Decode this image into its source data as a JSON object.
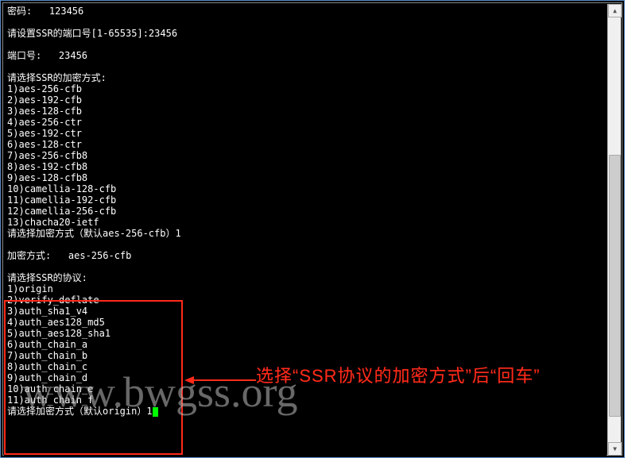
{
  "terminal": {
    "pwd_label": "密码:   123456",
    "port_prompt": "请设置SSR的端口号[1-65535]:23456",
    "port_label": "端口号:   23456",
    "enc_header": "请选择SSR的加密方式:",
    "enc_opts": [
      "1)aes-256-cfb",
      "2)aes-192-cfb",
      "3)aes-128-cfb",
      "4)aes-256-ctr",
      "5)aes-192-ctr",
      "6)aes-128-ctr",
      "7)aes-256-cfb8",
      "8)aes-192-cfb8",
      "9)aes-128-cfb8",
      "10)camellia-128-cfb",
      "11)camellia-192-cfb",
      "12)camellia-256-cfb",
      "13)chacha20-ietf"
    ],
    "enc_choose": "请选择加密方式（默认aes-256-cfb）1",
    "enc_result": "加密方式:   aes-256-cfb",
    "proto_header": "请选择SSR的协议:",
    "proto_opts": [
      "1)origin",
      "2)verify_deflate",
      "3)auth_sha1_v4",
      "4)auth_aes128_md5",
      "5)auth_aes128_sha1",
      "6)auth_chain_a",
      "7)auth_chain_b",
      "8)auth_chain_c",
      "9)auth_chain_d",
      "10)auth_chain_e",
      "11)auth_chain_f"
    ],
    "proto_choose": "请选择加密方式（默认origin）1"
  },
  "annotation": {
    "text": "选择“SSR协议的加密方式”后“回车”"
  },
  "watermark": {
    "text": "www.bwgss.org"
  }
}
